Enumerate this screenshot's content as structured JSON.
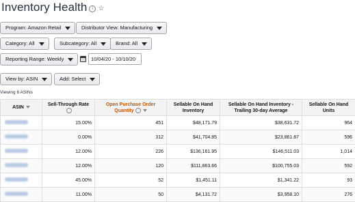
{
  "page": {
    "title": "Inventory Health"
  },
  "filters": {
    "program": "Program: Amazon Retail",
    "distributor_view": "Distributor View: Manufacturing",
    "category": "Category: All",
    "subcategory": "Subcategory: All",
    "brand": "Brand: All",
    "reporting_range": "Reporting Range: Weekly",
    "date_range": "10/04/20  -  10/10/20",
    "view_by": "View by: ASIN",
    "add": "Add: Select"
  },
  "viewing_text": "Viewing 6 ASINs",
  "table": {
    "headers": [
      "ASIN",
      "Sell-Through Rate",
      "Open Purchase Order Quantity",
      "Sellable On Hand Inventory",
      "Sellable On Hand Inventory - Trailing 30-day Average",
      "Sellable On Hand Units"
    ],
    "rows": [
      [
        "",
        "15.00%",
        "451",
        "$48,171.79",
        "$38,631.72",
        "964"
      ],
      [
        "",
        "0.00%",
        "312",
        "$41,704.85",
        "$23,861.87",
        "596"
      ],
      [
        "",
        "12.00%",
        "226",
        "$136,161.95",
        "$146,511.03",
        "1,014"
      ],
      [
        "",
        "12.00%",
        "120",
        "$111,863.66",
        "$100,755.03",
        "592"
      ],
      [
        "",
        "45.00%",
        "52",
        "$1,451.11",
        "$1,341.22",
        "93"
      ],
      [
        "",
        "11.00%",
        "50",
        "$4,131.72",
        "$3,958.10",
        "276"
      ]
    ]
  },
  "colors": {
    "accent_orange": "#c45500",
    "title": "#232f3e"
  }
}
